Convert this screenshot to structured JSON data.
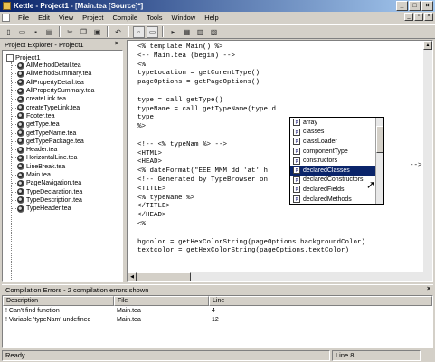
{
  "window": {
    "title": "Kettle - Project1 - [Main.tea [Source]*]"
  },
  "menu": [
    "File",
    "Edit",
    "View",
    "Project",
    "Compile",
    "Tools",
    "Window",
    "Help"
  ],
  "toolbar_icons": [
    "new-file-icon",
    "open-folder-icon",
    "save-icon",
    "save-all-icon",
    "cut-icon",
    "copy-icon",
    "paste-icon",
    "undo-icon",
    "panel-icon",
    "window-icon",
    "run-icon",
    "compile-icon",
    "tile-icon",
    "cascade-icon"
  ],
  "explorer": {
    "title": "Project Explorer - Project1",
    "root": "Project1",
    "files": [
      "AllMethodDetail.tea",
      "AllMethodSummary.tea",
      "AllPropertyDetail.tea",
      "AllPropertySummary.tea",
      "createLink.tea",
      "createTypeLink.tea",
      "Footer.tea",
      "getType.tea",
      "getTypeName.tea",
      "getTypePackage.tea",
      "Header.tea",
      "HorizontalLine.tea",
      "LineBreak.tea",
      "Main.tea",
      "PageNavigation.tea",
      "TypeDeclaration.tea",
      "TypeDescription.tea",
      "TypeHeader.tea"
    ]
  },
  "editor": {
    "lines": [
      "<% template Main() %>",
      "<-- Main.tea (begin) -->",
      "<%",
      "typeLocation = getCurentType()",
      "pageOptions = getPageOptions()",
      "",
      "type = call getType()",
      "typeName = call getTypeName(type.d",
      "type",
      "%>",
      "",
      "<!-- <% typeNam %> -->",
      "<HTML>",
      "<HEAD>",
      "<% dateFormat(\"EEE MMM dd 'at' h",
      "<!-- Generated by TypeBrowser on",
      "<TITLE>",
      "<% typeName %>",
      "</TITLE>",
      "</HEAD>",
      "<%",
      "",
      "bgcolor = getHexColorString(pageOptions.backgroundColor)",
      "textcolor = getHexColorString(pageOptions.textColor)"
    ],
    "trail_1": "-->"
  },
  "autocomplete": {
    "items": [
      "array",
      "classes",
      "classLoader",
      "componentType",
      "constructors",
      "declaredClasses",
      "declaredConstructors",
      "declaredFields",
      "declaredMethods"
    ],
    "selected": "declaredClasses"
  },
  "errors": {
    "title": "Compilation Errors - 2 compilation errors shown",
    "headers": [
      "Description",
      "File",
      "Line"
    ],
    "rows": [
      {
        "desc": "Can't find function",
        "file": "Main.tea",
        "line": "4"
      },
      {
        "desc": "Variable 'typeNam' undefined",
        "file": "Main.tea",
        "line": "12"
      }
    ]
  },
  "status": {
    "left": "Ready",
    "right": "Line 8"
  }
}
